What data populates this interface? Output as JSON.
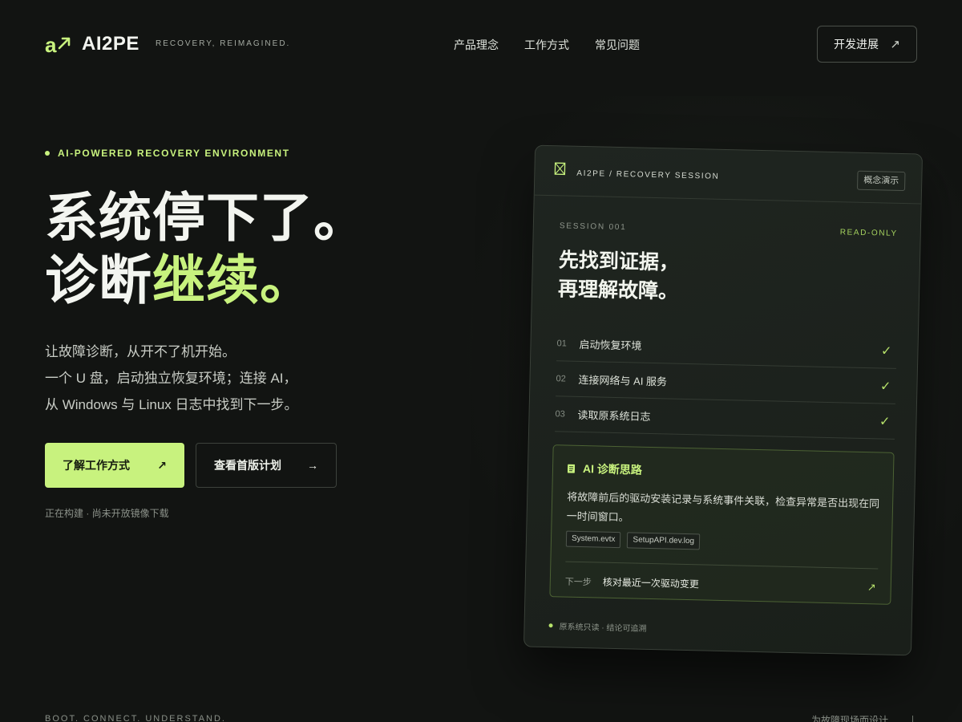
{
  "brand": {
    "name": "AI2PE",
    "tagline": "RECOVERY, REIMAGINED.",
    "accent_color": "#c8f27e",
    "logo_icon": "letter-a-arrow-logo"
  },
  "nav": {
    "items": [
      "产品理念",
      "工作方式",
      "常见问题"
    ],
    "cta_label": "开发进展",
    "cta_icon": "arrow-up-right-icon"
  },
  "hero": {
    "eyebrow": "AI-POWERED RECOVERY ENVIRONMENT",
    "headline_line1": "系统停下了。",
    "headline_line2_plain": "诊断",
    "headline_line2_accent": "继续。",
    "description": [
      "让故障诊断，从开不了机开始。",
      "一个 U 盘，启动独立恢复环境；连接 AI，",
      "从 Windows 与 Linux 日志中找到下一步。"
    ],
    "primary_button": "了解工作方式",
    "primary_icon": "arrow-up-right-icon",
    "secondary_button": "查看首版计划",
    "secondary_icon": "arrow-right-icon",
    "status_note": "正在构建 · 尚未开放镜像下载"
  },
  "card": {
    "title": "AI2PE / RECOVERY SESSION",
    "badge": "概念演示",
    "session_label": "SESSION 001",
    "mode_label": "READ-ONLY",
    "heading_line1": "先找到证据，",
    "heading_line2": "再理解故障。",
    "steps": [
      {
        "num": "01",
        "label": "启动恢复环境",
        "done": true
      },
      {
        "num": "02",
        "label": "连接网络与 AI 服务",
        "done": true
      },
      {
        "num": "03",
        "label": "读取原系统日志",
        "done": true
      }
    ],
    "ai_panel": {
      "title": "AI 诊断思路",
      "text": "将故障前后的驱动安装记录与系统事件关联，检查异常是否出现在同一时间窗口。",
      "tags": [
        "System.evtx",
        "SetupAPI.dev.log"
      ],
      "next_label": "下一步",
      "next_value": "核对最近一次驱动变更"
    },
    "footer_note": "原系统只读 · 结论可追溯"
  },
  "footer": {
    "left": "BOOT. CONNECT. UNDERSTAND.",
    "right": "为故障现场而设计"
  }
}
